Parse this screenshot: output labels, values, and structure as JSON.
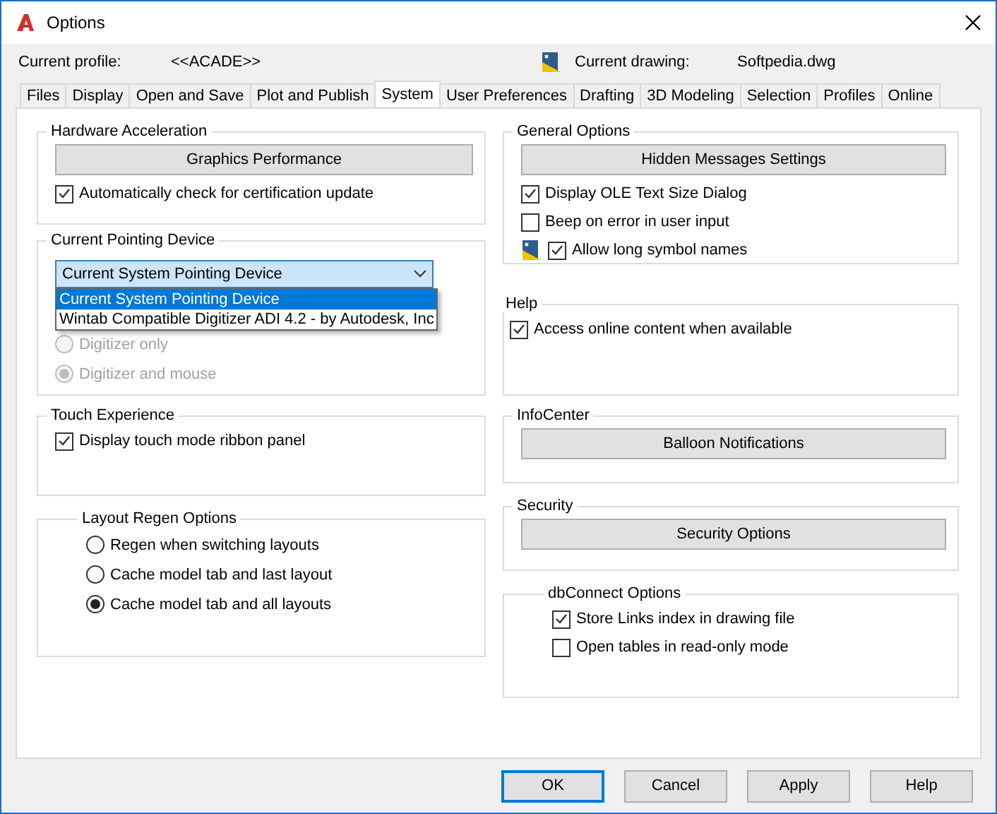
{
  "window": {
    "title": "Options"
  },
  "profile": {
    "label": "Current profile:",
    "value": "<<ACADE>>"
  },
  "drawing": {
    "label": "Current drawing:",
    "value": "Softpedia.dwg"
  },
  "tabs": [
    {
      "label": "Files",
      "selected": false
    },
    {
      "label": "Display",
      "selected": false
    },
    {
      "label": "Open and Save",
      "selected": false
    },
    {
      "label": "Plot and Publish",
      "selected": false
    },
    {
      "label": "System",
      "selected": true
    },
    {
      "label": "User Preferences",
      "selected": false
    },
    {
      "label": "Drafting",
      "selected": false
    },
    {
      "label": "3D Modeling",
      "selected": false
    },
    {
      "label": "Selection",
      "selected": false
    },
    {
      "label": "Profiles",
      "selected": false
    },
    {
      "label": "Online",
      "selected": false
    }
  ],
  "left_groups": [
    {
      "title": "Hardware Acceleration",
      "items": [
        {
          "kind": "button",
          "label": "Graphics Performance"
        },
        {
          "kind": "checkbox",
          "label": "Automatically check for certification update",
          "checked": true
        }
      ]
    },
    {
      "title": "Current Pointing Device",
      "items": [
        {
          "kind": "dropdown",
          "value": "Current System Pointing Device",
          "expanded": true,
          "options": [
            {
              "label": "Current System Pointing Device",
              "selected": true
            },
            {
              "label": "Wintab Compatible Digitizer ADI 4.2 - by Autodesk, Inc",
              "selected": false
            }
          ]
        },
        {
          "kind": "radio",
          "label": "Digitizer only",
          "selected": false,
          "disabled": true
        },
        {
          "kind": "radio",
          "label": "Digitizer and mouse",
          "selected": true,
          "disabled": true
        }
      ]
    },
    {
      "title": "Touch Experience",
      "items": [
        {
          "kind": "checkbox",
          "label": "Display touch mode ribbon panel",
          "checked": true
        }
      ]
    },
    {
      "title": "Layout Regen Options",
      "items": [
        {
          "kind": "radio",
          "label": "Regen when switching layouts",
          "selected": false,
          "disabled": false
        },
        {
          "kind": "radio",
          "label": "Cache model tab and last layout",
          "selected": false,
          "disabled": false
        },
        {
          "kind": "radio",
          "label": "Cache model tab and all layouts",
          "selected": true,
          "disabled": false
        }
      ]
    }
  ],
  "right_groups": [
    {
      "title": "General Options",
      "items": [
        {
          "kind": "button",
          "label": "Hidden Messages Settings"
        },
        {
          "kind": "checkbox",
          "label": "Display OLE Text Size Dialog",
          "checked": true
        },
        {
          "kind": "checkbox",
          "label": "Beep on error in user input",
          "checked": false
        },
        {
          "kind": "checkbox",
          "label": "Allow long symbol names",
          "checked": true,
          "saved_in_drawing": true
        }
      ]
    },
    {
      "title": "Help",
      "items": [
        {
          "kind": "checkbox",
          "label": "Access online content when available",
          "checked": true
        }
      ]
    },
    {
      "title": "InfoCenter",
      "items": [
        {
          "kind": "button",
          "label": "Balloon Notifications"
        }
      ]
    },
    {
      "title": "Security",
      "items": [
        {
          "kind": "button",
          "label": "Security Options"
        }
      ]
    },
    {
      "title": "dbConnect Options",
      "items": [
        {
          "kind": "checkbox",
          "label": "Store Links index in drawing file",
          "checked": true
        },
        {
          "kind": "checkbox",
          "label": "Open tables in read-only mode",
          "checked": false
        }
      ]
    }
  ],
  "buttons": [
    {
      "label": "OK",
      "default": true
    },
    {
      "label": "Cancel",
      "default": false
    },
    {
      "label": "Apply",
      "default": false
    },
    {
      "label": "Help",
      "default": false
    }
  ]
}
